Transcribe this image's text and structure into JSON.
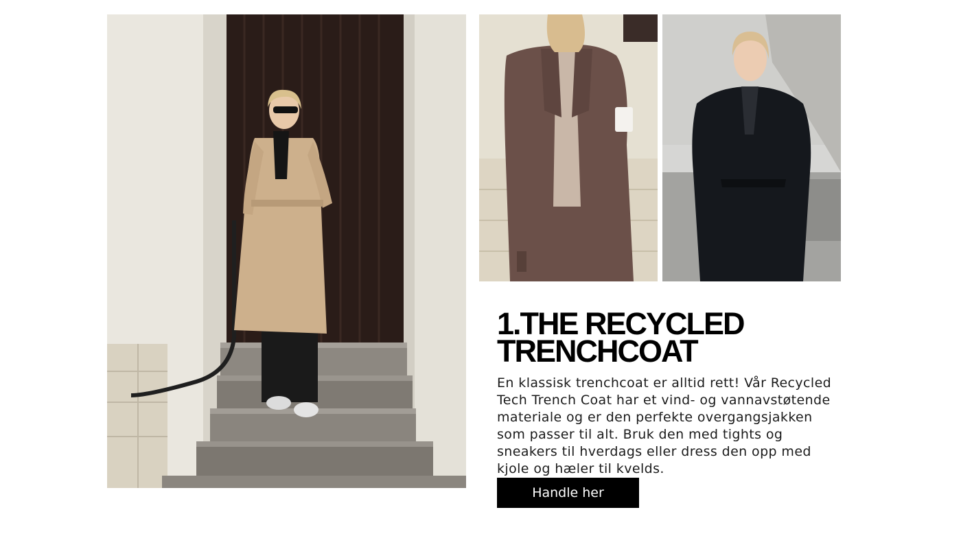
{
  "headline": {
    "line1": "1.THE RECYCLED",
    "line2": "TRENCHCOAT"
  },
  "description": "En klassisk trenchcoat er alltid rett! Vår Recycled Tech Trench Coat har et vind- og vannavstøtende materiale og er den perfekte overgangsjakken som passer til alt. Bruk den med tights og sneakers til hverdags eller dress den opp med kjole og hæler til kvelds.",
  "cta": {
    "label": "Handle her"
  },
  "colors": {
    "cta_background": "#000000",
    "cta_text": "#ffffff",
    "coat_beige": "#cdb08c",
    "coat_brown": "#6b5049",
    "coat_black": "#15181d"
  }
}
